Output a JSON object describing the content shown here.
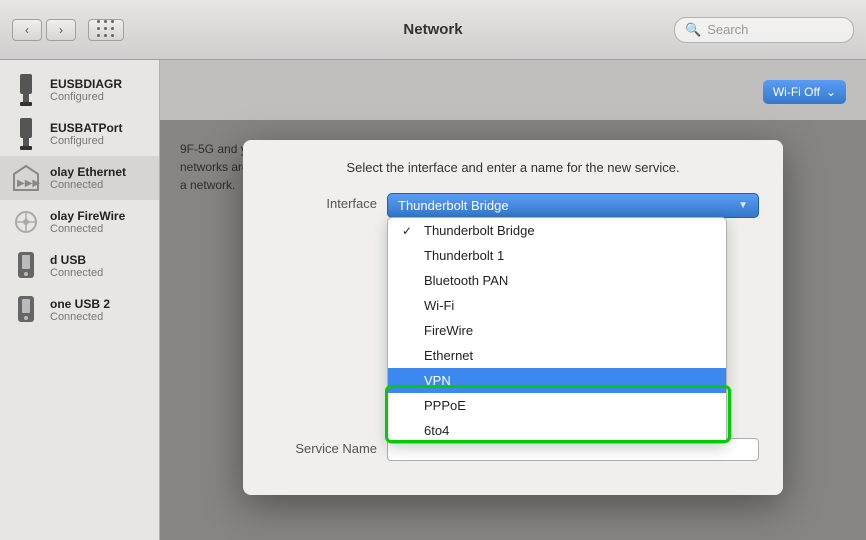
{
  "titlebar": {
    "title": "Network",
    "search_placeholder": "Search",
    "nav_back": "‹",
    "nav_forward": "›"
  },
  "dialog": {
    "title": "Select the interface and enter a name for the new service.",
    "interface_label": "Interface",
    "service_name_label": "Service Name",
    "service_name_value": "",
    "dropdown": {
      "selected": "Thunderbolt Bridge",
      "items": [
        {
          "label": "Thunderbolt Bridge",
          "checked": true
        },
        {
          "label": "Thunderbolt 1",
          "checked": false
        },
        {
          "label": "Bluetooth PAN",
          "checked": false
        },
        {
          "label": "Wi-Fi",
          "checked": false
        },
        {
          "label": "FireWire",
          "checked": false
        },
        {
          "label": "Ethernet",
          "checked": false
        },
        {
          "label": "VPN",
          "checked": false,
          "highlighted": true
        },
        {
          "label": "PPPoE",
          "checked": false
        },
        {
          "label": "6to4",
          "checked": false
        }
      ]
    }
  },
  "sidebar": {
    "items": [
      {
        "name": "EUSBDIAGR",
        "status": "Configured",
        "icon": "usb"
      },
      {
        "name": "EUSBATPort",
        "status": "Configured",
        "icon": "usb"
      },
      {
        "name": "olay Ethernet",
        "status": "Connected",
        "icon": "ethernet"
      },
      {
        "name": "olay FireWire",
        "status": "Connected",
        "icon": "firewire"
      },
      {
        "name": "d USB",
        "status": "Connected",
        "icon": "usb-phone"
      },
      {
        "name": "one USB 2",
        "status": "Connected",
        "icon": "usb-phone2"
      }
    ]
  },
  "right_panel": {
    "wifi_label": "Wi-Fi Off",
    "network_name": "9F-5G and",
    "body_text": "you will be joined automatically. If no known networks are available, you will have to manually select a network."
  },
  "colors": {
    "accent": "#3478c9",
    "highlight_green": "#00cc00",
    "selected_blue": "#3d88ee"
  }
}
